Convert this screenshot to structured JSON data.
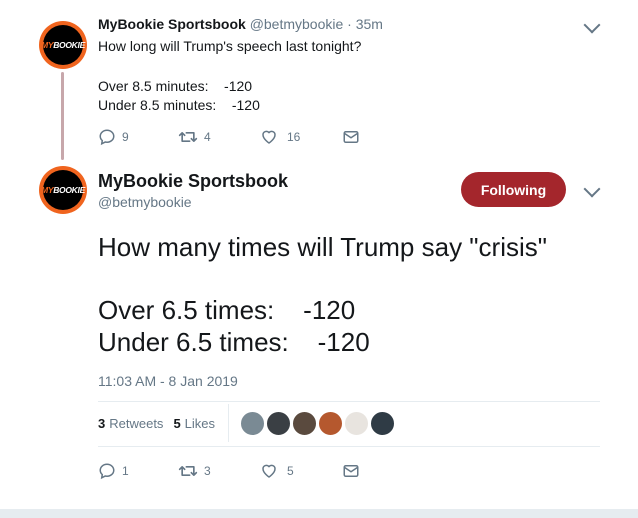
{
  "reply_tweet": {
    "display_name": "MyBookie Sportsbook",
    "handle": "@betmybookie",
    "separator": "·",
    "time": "35m",
    "lines": [
      "How long will Trump's speech last tonight?",
      "",
      "Over 8.5 minutes:    -120",
      "Under 8.5 minutes:    -120"
    ],
    "actions": {
      "replies": "9",
      "retweets": "4",
      "likes": "16"
    }
  },
  "main_tweet": {
    "display_name": "MyBookie Sportsbook",
    "handle": "@betmybookie",
    "follow_label": "Following",
    "lines": [
      "How many times will Trump say \"crisis\"",
      "",
      "Over 6.5 times:    -120",
      "Under 6.5 times:    -120"
    ],
    "timestamp": "11:03 AM - 8 Jan 2019",
    "stats": {
      "retweets_count": "3",
      "retweets_label": "Retweets",
      "likes_count": "5",
      "likes_label": "Likes"
    },
    "actions": {
      "replies": "1",
      "retweets": "3",
      "likes": "5"
    }
  },
  "avatar_logo": {
    "prefix": "MY",
    "suffix": "BOOKIE"
  },
  "colors": {
    "follow_button": "#a4262c",
    "thread_line": "#c7a7ab",
    "avatar_ring": "#f0641e",
    "muted_text": "#657786",
    "liker_avatars": [
      "#7a8a94",
      "#3a3f44",
      "#5a4a3e",
      "#b5582e",
      "#e8e4df",
      "#2f3b45"
    ]
  },
  "icons": [
    "reply-icon",
    "retweet-icon",
    "heart-icon",
    "direct-message-icon",
    "chevron-down-icon"
  ]
}
